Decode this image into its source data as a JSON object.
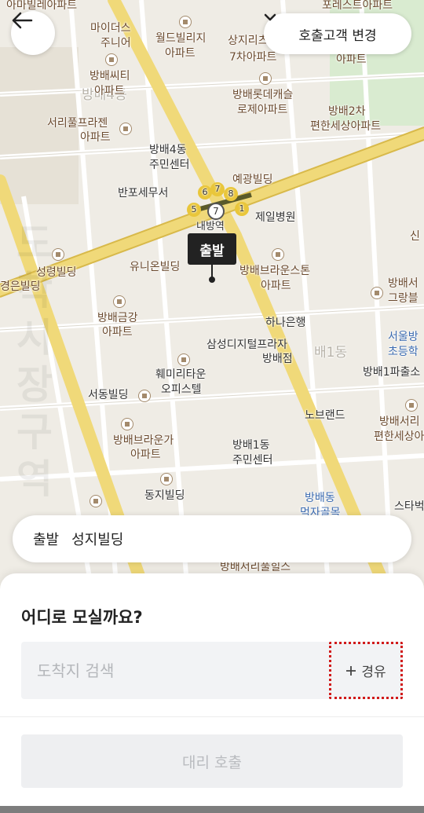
{
  "header": {
    "back_icon": "arrow-left-icon",
    "change_customer_label": "호출고객 변경",
    "change_customer_icon": "chevron-down-icon"
  },
  "map": {
    "pin_label": "출발",
    "watermark": "도착시장구역",
    "station_label": "내방역",
    "line_numbers": [
      "6",
      "7",
      "8",
      "5",
      "7",
      "1"
    ],
    "district_labels": [
      "방배4동",
      "배1동"
    ],
    "pois": [
      {
        "key": "p1",
        "text": "아마빌레아파트"
      },
      {
        "key": "p2",
        "text": "포레스트아파트"
      },
      {
        "key": "p3",
        "text": "마이더스"
      },
      {
        "key": "p4",
        "text": "주니어"
      },
      {
        "key": "p5",
        "text": "월드빌리지"
      },
      {
        "key": "p6",
        "text": "아파트"
      },
      {
        "key": "p7",
        "text": "상지리츠빌"
      },
      {
        "key": "p8",
        "text": "7차아파트"
      },
      {
        "key": "p9",
        "text": "아파트"
      },
      {
        "key": "p10",
        "text": "방배씨티"
      },
      {
        "key": "p11",
        "text": "아파트"
      },
      {
        "key": "p12",
        "text": "방배롯데캐슬"
      },
      {
        "key": "p13",
        "text": "로제아파트"
      },
      {
        "key": "p14",
        "text": "방배2차"
      },
      {
        "key": "p15",
        "text": "편한세상아파트"
      },
      {
        "key": "p16",
        "text": "서리풀프라젠"
      },
      {
        "key": "p17",
        "text": "아파트"
      },
      {
        "key": "p18",
        "text": "방배4동"
      },
      {
        "key": "p19",
        "text": "주민센터"
      },
      {
        "key": "p20",
        "text": "예광빌딩"
      },
      {
        "key": "p21",
        "text": "반포세무서"
      },
      {
        "key": "p22",
        "text": "제일병원"
      },
      {
        "key": "p23",
        "text": "유니온빌딩"
      },
      {
        "key": "p24",
        "text": "방배브라운스톤"
      },
      {
        "key": "p25",
        "text": "아파트"
      },
      {
        "key": "p26",
        "text": "성령빌딩"
      },
      {
        "key": "p27",
        "text": "방배금강"
      },
      {
        "key": "p28",
        "text": "아파트"
      },
      {
        "key": "p29",
        "text": "하나은행"
      },
      {
        "key": "p30",
        "text": "삼성디지털프라자"
      },
      {
        "key": "p31",
        "text": "방배점"
      },
      {
        "key": "p32",
        "text": "훼미리타운"
      },
      {
        "key": "p33",
        "text": "오피스텔"
      },
      {
        "key": "p34",
        "text": "서동빌딩"
      },
      {
        "key": "p35",
        "text": "노브랜드"
      },
      {
        "key": "p36",
        "text": "방배1파출소"
      },
      {
        "key": "p37",
        "text": "방배브라운가"
      },
      {
        "key": "p38",
        "text": "아파트"
      },
      {
        "key": "p39",
        "text": "방배1동"
      },
      {
        "key": "p40",
        "text": "주민센터"
      },
      {
        "key": "p41",
        "text": "동지빌딩"
      },
      {
        "key": "p42",
        "text": "방배서리"
      },
      {
        "key": "p43",
        "text": "편한세상아"
      },
      {
        "key": "p44",
        "text": "서울방"
      },
      {
        "key": "p45",
        "text": "초등학"
      },
      {
        "key": "p46",
        "text": "방배동"
      },
      {
        "key": "p47",
        "text": "먹자골목"
      },
      {
        "key": "p48",
        "text": "스타벅"
      },
      {
        "key": "p49",
        "text": "방배서리풀힐스"
      },
      {
        "key": "p50",
        "text": "신"
      },
      {
        "key": "p51",
        "text": "방배서"
      },
      {
        "key": "p52",
        "text": "그랑블"
      },
      {
        "key": "p53",
        "text": "경은빌딩"
      }
    ]
  },
  "origin": {
    "label": "출발",
    "place": "성지빌딩"
  },
  "sheet": {
    "title": "어디로 모실까요?",
    "search_placeholder": "도착지 검색",
    "waypoint_label": "경유",
    "waypoint_icon": "plus-icon",
    "call_button_label": "대리 호출"
  }
}
